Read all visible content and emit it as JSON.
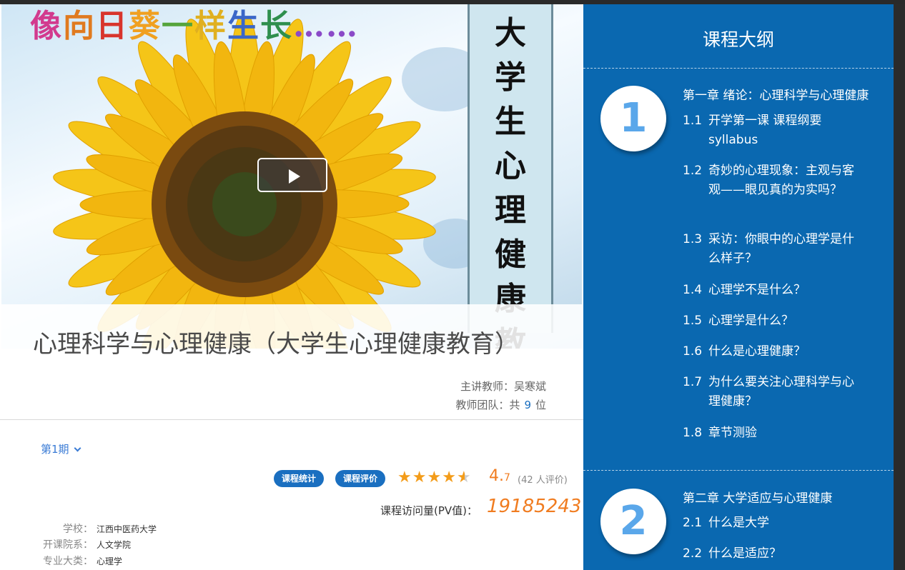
{
  "hero": {
    "banner_chars": [
      "像",
      "向",
      "日",
      "葵",
      "一",
      "样",
      "生",
      "长",
      "……"
    ],
    "vertical_title": "大学生心理健康教育"
  },
  "course": {
    "title": "心理科学与心理健康（大学生心理健康教育）",
    "teacher_label": "主讲教师：",
    "teacher_name": "吴寒斌",
    "team_label": "教师团队：共",
    "team_count": "9",
    "team_unit": "位",
    "term_label": "第1期",
    "stats_button": "课程统计",
    "review_button": "课程评价",
    "rating_whole": "4.",
    "rating_decimal": "7",
    "rating_value": 4.7,
    "rating_count": "(42 人评价)",
    "pv_label": "课程访问量(PV值)：",
    "pv_value": "19185243",
    "info": [
      {
        "label": "学校：",
        "value": "江西中医药大学"
      },
      {
        "label": "开课院系：",
        "value": "人文学院"
      },
      {
        "label": "专业大类：",
        "value": "心理学"
      }
    ]
  },
  "outline": {
    "title": "课程大纲",
    "chapters": [
      {
        "number": "1",
        "title": "第一章 绪论：心理科学与心理健康",
        "lessons": [
          {
            "no": "1.1",
            "text": "开学第一课 课程纲要 syllabus"
          },
          {
            "no": "1.2",
            "text": "奇妙的心理现象：主观与客观——眼见真的为实吗？"
          },
          {
            "no": "1.3",
            "text": "采访：你眼中的心理学是什么样子？"
          },
          {
            "no": "1.4",
            "text": "心理学不是什么？"
          },
          {
            "no": "1.5",
            "text": "心理学是什么？"
          },
          {
            "no": "1.6",
            "text": "什么是心理健康？"
          },
          {
            "no": "1.7",
            "text": "为什么要关注心理科学与心理健康？"
          },
          {
            "no": "1.8",
            "text": "章节测验"
          }
        ]
      },
      {
        "number": "2",
        "title": "第二章 大学适应与心理健康",
        "lessons": [
          {
            "no": "2.1",
            "text": "什么是大学"
          },
          {
            "no": "2.2",
            "text": "什么是适应？"
          }
        ]
      }
    ]
  },
  "colors": {
    "panel_blue": "#0a68b0",
    "accent_orange": "#f07c20",
    "badge_blue": "#1a6fc0",
    "star": "#f39c1a",
    "circle_number": "#5aa7ea"
  }
}
